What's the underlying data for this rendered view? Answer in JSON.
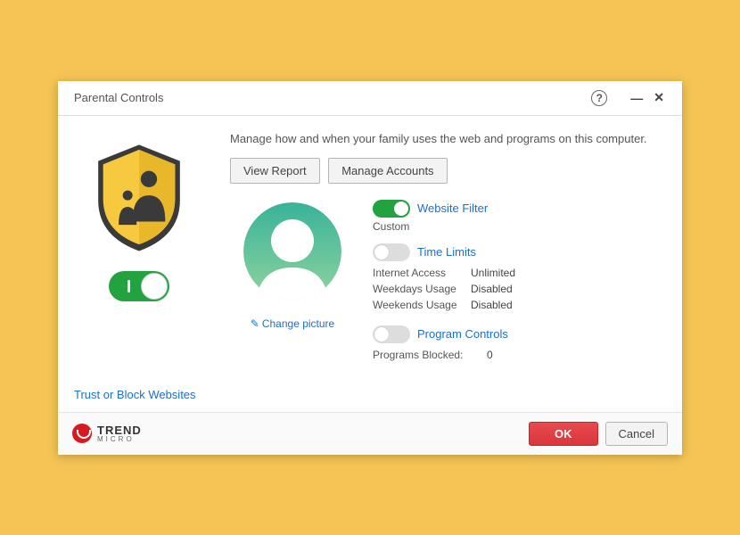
{
  "window": {
    "title": "Parental Controls"
  },
  "description": "Manage how and when your family uses the web and programs on this computer.",
  "buttons": {
    "view_report": "View Report",
    "manage_accounts": "Manage Accounts",
    "ok": "OK",
    "cancel": "Cancel"
  },
  "avatar": {
    "change_picture": "Change picture"
  },
  "features": {
    "website_filter": {
      "label": "Website Filter",
      "status": "Custom",
      "on": true
    },
    "time_limits": {
      "label": "Time Limits",
      "on": false,
      "rows": [
        {
          "key": "Internet Access",
          "val": "Unlimited"
        },
        {
          "key": "Weekdays Usage",
          "val": "Disabled"
        },
        {
          "key": "Weekends Usage",
          "val": "Disabled"
        }
      ]
    },
    "program_controls": {
      "label": "Program Controls",
      "on": false,
      "blocked_label": "Programs Blocked:",
      "blocked_count": "0"
    }
  },
  "links": {
    "trust_block": "Trust or Block Websites"
  },
  "brand": {
    "line1": "TREND",
    "line2": "MICRO"
  }
}
